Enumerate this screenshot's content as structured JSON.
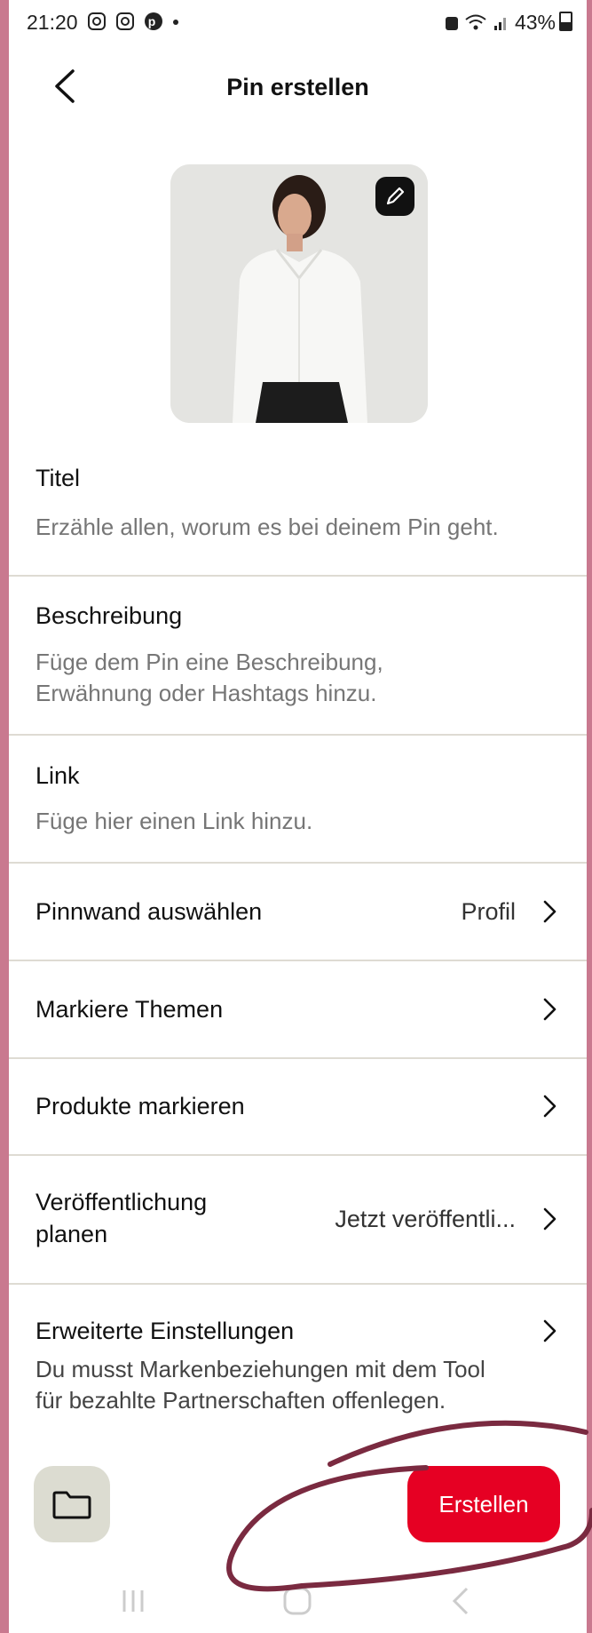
{
  "status_bar": {
    "time": "21:20",
    "left_icons": [
      "instagram-icon",
      "instagram-icon",
      "pinterest-icon",
      "dot"
    ],
    "battery": "43%"
  },
  "header": {
    "title": "Pin erstellen"
  },
  "fields": {
    "title": {
      "label": "Titel",
      "placeholder": "Erzähle allen, worum es bei deinem Pin geht."
    },
    "description": {
      "label": "Beschreibung",
      "placeholder_line1": "Füge dem Pin eine Beschreibung,",
      "placeholder_line2": "Erwähnung oder Hashtags hinzu."
    },
    "link": {
      "label": "Link",
      "placeholder": "Füge hier einen Link hinzu."
    }
  },
  "rows": {
    "board": {
      "label": "Pinnwand auswählen",
      "value": "Profil"
    },
    "topics": {
      "label": "Markiere Themen"
    },
    "products": {
      "label": "Produkte markieren"
    },
    "schedule": {
      "label_line1": "Veröffentlichung",
      "label_line2": "planen",
      "value": "Jetzt veröffentli..."
    },
    "advanced": {
      "label": "Erweiterte Einstellungen",
      "note_line1": "Du musst Markenbeziehungen mit dem Tool",
      "note_line2": "für bezahlte Partnerschaften offenlegen."
    }
  },
  "bottom": {
    "create_label": "Erstellen",
    "folder_icon": "folder-icon"
  },
  "colors": {
    "accent": "#e60023",
    "frame_border": "#c9798f",
    "annotation": "#7a2a40"
  }
}
